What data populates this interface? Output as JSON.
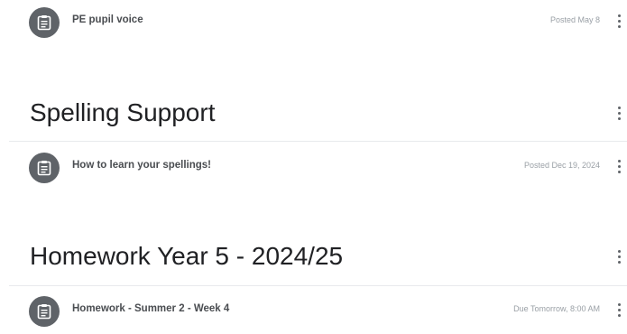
{
  "items": [
    {
      "title": "PE pupil voice",
      "meta": "Posted May 8",
      "icon": "assignment-clipboard-icon"
    },
    {
      "title": "How to learn your spellings!",
      "meta": "Posted Dec 19, 2024",
      "icon": "assignment-clipboard-icon"
    },
    {
      "title": "Homework - Summer 2 - Week 4",
      "meta": "Due Tomorrow, 8:00 AM",
      "icon": "assignment-clipboard-icon"
    }
  ],
  "topics": [
    {
      "title": "Spelling Support"
    },
    {
      "title": "Homework Year 5 - 2024/25"
    }
  ],
  "colors": {
    "icon_background": "#5f6368",
    "divider": "#e8eaed",
    "meta_text": "#9aa0a6"
  }
}
